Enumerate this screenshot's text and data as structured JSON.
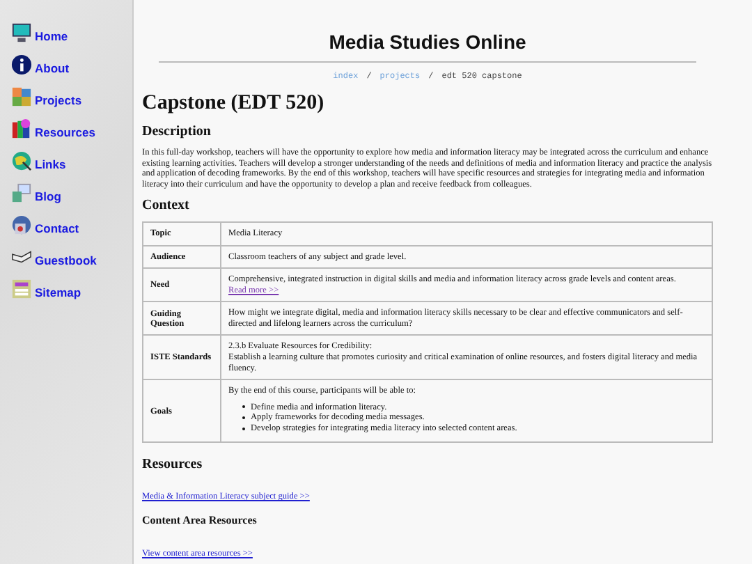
{
  "sidebar": {
    "items": [
      {
        "label": "Home"
      },
      {
        "label": "About"
      },
      {
        "label": "Projects"
      },
      {
        "label": "Resources"
      },
      {
        "label": "Links"
      },
      {
        "label": "Blog"
      },
      {
        "label": "Contact"
      },
      {
        "label": "Guestbook"
      },
      {
        "label": "Sitemap"
      }
    ]
  },
  "site_title": "Media Studies Online",
  "breadcrumb": {
    "links": [
      "index",
      "projects"
    ],
    "separator": "/",
    "current": "edt 520 capstone"
  },
  "page_title": "Capstone (EDT 520)",
  "description": {
    "heading": "Description",
    "text": "In this full-day workshop, teachers will have the opportunity to explore how media and information literacy may be integrated across the curriculum and enhance existing learning activities. Teachers will develop a stronger understanding of the needs and definitions of media and information literacy and practice the analysis and application of decoding frameworks. By the end of this workshop, teachers will have specific resources and strategies for integrating media and information literacy into their curriculum and have the opportunity to develop a plan and receive feedback from colleagues."
  },
  "context": {
    "heading": "Context",
    "rows": [
      {
        "label": "Topic",
        "lines": [
          "Media Literacy"
        ]
      },
      {
        "label": "Audience",
        "lines": [
          "Classroom teachers of any subject and grade level."
        ]
      },
      {
        "label": "Need",
        "lines": [
          "Comprehensive, integrated instruction in digital skills and media and information literacy across grade levels and content areas."
        ],
        "link": "Read more >>"
      },
      {
        "label": "Guiding Question",
        "lines": [
          "How might we integrate digital, media and information literacy skills necessary to be clear and effective communicators and self-directed and lifelong learners across the curriculum?"
        ]
      },
      {
        "label": "ISTE Standards",
        "lines": [
          "2.3.b Evaluate Resources for Credibility:",
          "Establish a learning culture that promotes curiosity and critical examination of online resources, and fosters digital literacy and media fluency."
        ]
      },
      {
        "label": "Goals",
        "lines": [
          "By the end of this course, participants will be able to:"
        ],
        "items": [
          "Define media and information literacy.",
          "Apply frameworks for decoding media messages.",
          "Develop strategies for integrating media literacy into selected content areas."
        ]
      }
    ]
  },
  "resources": {
    "heading": "Resources",
    "link": "Media & Information Literacy subject guide >>",
    "subheading": "Content Area Resources",
    "sublink": "View content area resources >>"
  }
}
